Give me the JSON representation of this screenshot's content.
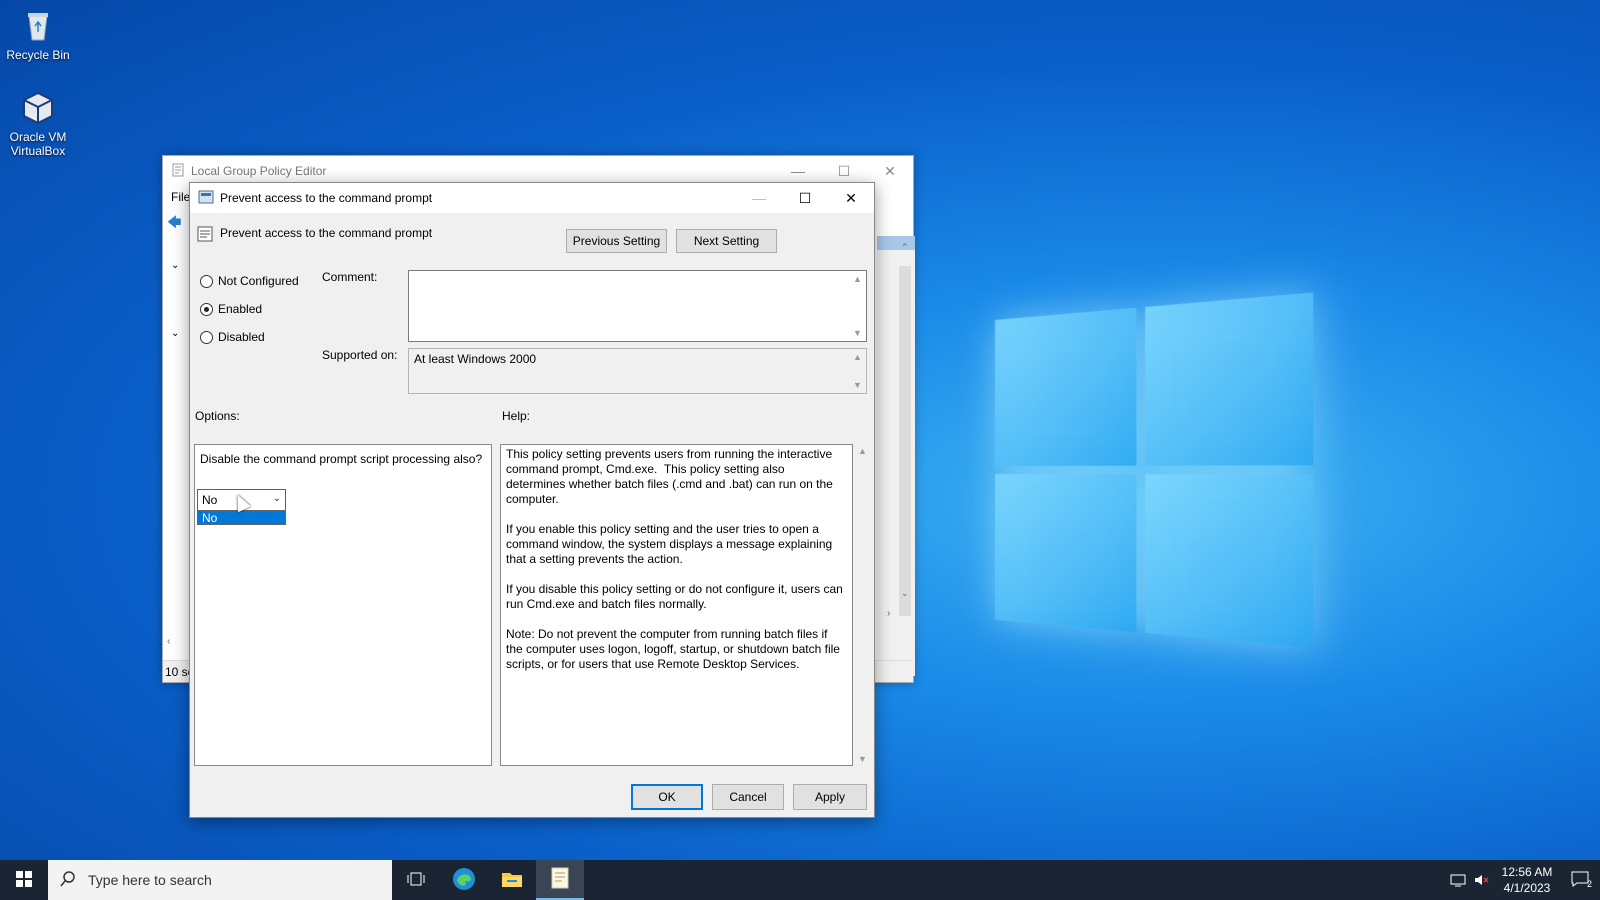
{
  "desktop": {
    "icons": [
      {
        "label": "Recycle Bin"
      },
      {
        "label": "Oracle VM VirtualBox"
      }
    ]
  },
  "gpe_window": {
    "title": "Local Group Policy Editor",
    "menu_file": "File",
    "status": "10 se"
  },
  "dialog": {
    "title": "Prevent access to the command prompt",
    "policy_name": "Prevent access to the command prompt",
    "previous_setting": "Previous Setting",
    "next_setting": "Next Setting",
    "radio": {
      "not_configured": "Not Configured",
      "enabled": "Enabled",
      "disabled": "Disabled",
      "selected": "enabled"
    },
    "comment_label": "Comment:",
    "comment_value": "",
    "supported_label": "Supported on:",
    "supported_value": "At least Windows 2000",
    "options_label": "Options:",
    "help_label": "Help:",
    "option_question": "Disable the command prompt script processing also?",
    "option_selected": "No",
    "option_list": [
      "No"
    ],
    "help_text": "This policy setting prevents users from running the interactive command prompt, Cmd.exe.  This policy setting also determines whether batch files (.cmd and .bat) can run on the computer.\n\nIf you enable this policy setting and the user tries to open a command window, the system displays a message explaining that a setting prevents the action.\n\nIf you disable this policy setting or do not configure it, users can run Cmd.exe and batch files normally.\n\nNote: Do not prevent the computer from running batch files if the computer uses logon, logoff, startup, or shutdown batch file scripts, or for users that use Remote Desktop Services.",
    "ok": "OK",
    "cancel": "Cancel",
    "apply": "Apply"
  },
  "taskbar": {
    "search_placeholder": "Type here to search",
    "time": "12:56 AM",
    "date": "4/1/2023",
    "notifications_count": "2"
  },
  "colors": {
    "accent": "#0078d7",
    "taskbar": "#1b2433"
  }
}
